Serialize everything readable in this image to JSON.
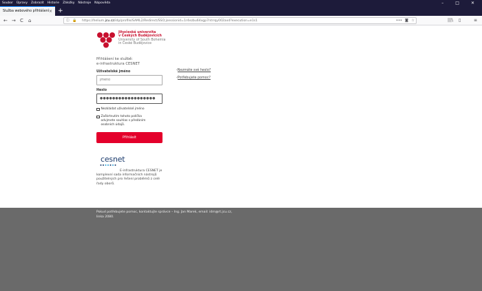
{
  "menubar": {
    "items": [
      "Soubor",
      "Úpravy",
      "Zobrazit",
      "Historie",
      "Záložky",
      "Nástroje",
      "Nápověda"
    ],
    "minimize": "–",
    "maximize": "□",
    "close": "✕"
  },
  "tab": {
    "title": "Služba webového přihlášení",
    "close": "×",
    "new_tab": "+"
  },
  "navbar": {
    "back": "←",
    "forward": "→",
    "reload": "C",
    "home": "⌂",
    "url_prefix": "https://helium.",
    "url_domain": "jcu.cz",
    "url_rest": "/idp/profile/SAML2/Redirect/SSO;jsessionid=1r4ezbu64xgp7ntrrqy002axd?execution=e1s1",
    "more": "•••",
    "library": "|||\\",
    "sidebar": "▯",
    "menu": "≡"
  },
  "page": {
    "university": {
      "line1": "Jihočeská univerzita",
      "line2": "v Českých Budějovicích",
      "line3": "University of South Bohemia",
      "line4": "in České Budějovice"
    },
    "service_line1": "Přihlášení ke službě:",
    "service_line2": "e-infrastruktura CESNET",
    "username_label": "Uživatelské jméno",
    "username_placeholder": "Jméno",
    "password_label": "Heslo",
    "password_value": "●●●●●●●●●●●●●●●●●●",
    "remember_label": "Nezkládat uživatelské jméno",
    "consent_label": "Zaškrtnutím tohoto políčka odvjmete souhlas s předáním osobních údajů.",
    "login_button": "Přihlásit",
    "forgot_password": "Nezmáte své heslo?",
    "need_help": "Potřebujete pomoc?",
    "link_marker": "‹",
    "cesnet_logo": "cesnet",
    "cesnet_description": "E-infrastruktura CESNET je komplexní sada informačních nástrojů použitelných pro řešení problémů z celé řady oborů."
  },
  "footer": {
    "text": "Pokud potřebujete pomoc, kontaktujte správce – Ing. Jan Marek, email: idm@rt.jcu.cz, linka 2080."
  },
  "colors": {
    "accent": "#e4002b",
    "brand_red": "#c8102e",
    "menubar": "#1d1b3a",
    "footer": "#6a6a6a"
  }
}
